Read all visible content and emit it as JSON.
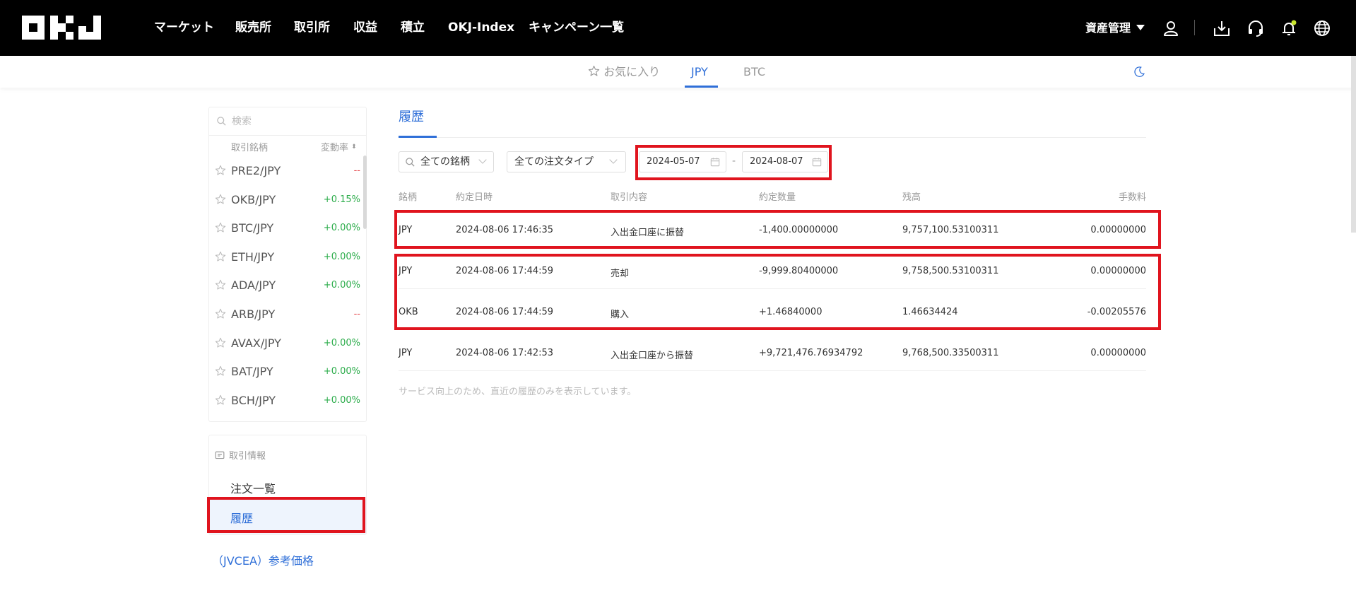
{
  "nav": {
    "items": [
      "マーケット",
      "販売所",
      "取引所",
      "収益",
      "積立",
      "OKJ-Index",
      "キャンペーン一覧"
    ],
    "asset_label": "資産管理"
  },
  "subtabs": {
    "favorites": "お気に入り",
    "jpy": "JPY",
    "btc": "BTC"
  },
  "sidebar": {
    "search_placeholder": "検索",
    "col_pair": "取引銘柄",
    "col_change": "変動率",
    "markets": [
      {
        "pair": "PRE2/JPY",
        "change": "--",
        "dir": "neg"
      },
      {
        "pair": "OKB/JPY",
        "change": "+0.15%",
        "dir": "pos"
      },
      {
        "pair": "BTC/JPY",
        "change": "+0.00%",
        "dir": "pos"
      },
      {
        "pair": "ETH/JPY",
        "change": "+0.00%",
        "dir": "pos"
      },
      {
        "pair": "ADA/JPY",
        "change": "+0.00%",
        "dir": "pos"
      },
      {
        "pair": "ARB/JPY",
        "change": "--",
        "dir": "neg"
      },
      {
        "pair": "AVAX/JPY",
        "change": "+0.00%",
        "dir": "pos"
      },
      {
        "pair": "BAT/JPY",
        "change": "+0.00%",
        "dir": "pos"
      },
      {
        "pair": "BCH/JPY",
        "change": "+0.00%",
        "dir": "pos"
      }
    ],
    "info_title": "取引情報",
    "orders": "注文一覧",
    "history": "履歴",
    "jvcea": "（JVCEA）参考価格"
  },
  "main": {
    "tab": "履歴",
    "filter_symbol": "全ての銘柄",
    "filter_type": "全ての注文タイプ",
    "date_from": "2024-05-07",
    "date_sep": "-",
    "date_to": "2024-08-07",
    "headers": [
      "銘柄",
      "約定日時",
      "取引内容",
      "約定数量",
      "残高",
      "手数料"
    ],
    "rows": [
      {
        "symbol": "JPY",
        "time": "2024-08-06 17:46:35",
        "kind": "入出金口座に振替",
        "qty": "-1,400.00000000",
        "qty_dir": "neg",
        "balance": "9,757,100.53100311",
        "fee": "0.00000000",
        "fee_dir": ""
      },
      {
        "symbol": "JPY",
        "time": "2024-08-06 17:44:59",
        "kind": "売却",
        "qty": "-9,999.80400000",
        "qty_dir": "neg",
        "balance": "9,758,500.53100311",
        "fee": "0.00000000",
        "fee_dir": ""
      },
      {
        "symbol": "OKB",
        "time": "2024-08-06 17:44:59",
        "kind": "購入",
        "qty": "+1.46840000",
        "qty_dir": "pos",
        "balance": "1.46634424",
        "fee": "-0.00205576",
        "fee_dir": "neg"
      },
      {
        "symbol": "JPY",
        "time": "2024-08-06 17:42:53",
        "kind": "入出金口座から振替",
        "qty": "+9,721,476.76934792",
        "qty_dir": "pos",
        "balance": "9,768,500.33500311",
        "fee": "0.00000000",
        "fee_dir": ""
      }
    ],
    "note": "サービス向上のため、直近の履歴のみを表示しています。"
  },
  "colors": {
    "accent": "#2f6fd8",
    "positive": "#2bac4a",
    "negative": "#e5484d",
    "highlight": "#e0141e"
  }
}
